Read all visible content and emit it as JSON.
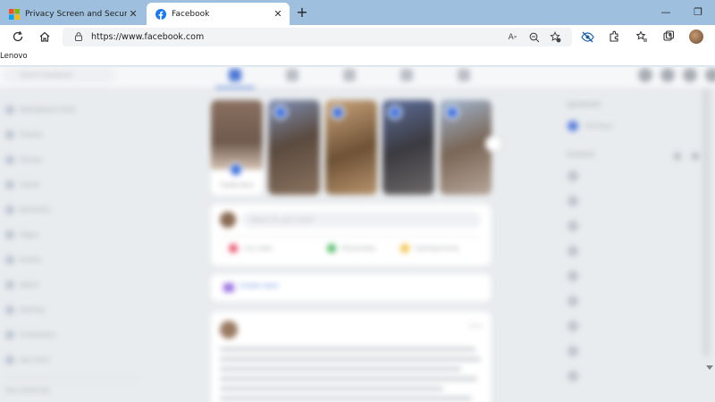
{
  "browser": {
    "tabs": [
      {
        "title": "Privacy Screen and Security Blur",
        "favicon": "microsoft-logo-icon",
        "active": false
      },
      {
        "title": "Facebook",
        "favicon": "facebook-logo-icon",
        "active": true
      }
    ],
    "url": "https://www.facebook.com",
    "favorites": [
      "Lenovo"
    ],
    "colors": {
      "tab_strip": "#9ec0de",
      "toolbar": "#ffffff",
      "omnibox": "#f1f3f4"
    },
    "icons": [
      "refresh-icon",
      "home-icon",
      "lock-icon",
      "read-aloud-icon",
      "zoom-out-icon",
      "add-favorite-icon",
      "eye-slash-icon",
      "extensions-icon",
      "favorites-icon",
      "collections-icon",
      "profile-avatar"
    ]
  },
  "page": {
    "state": "blurred",
    "colors": {
      "background": "#e9ecef",
      "card": "#ffffff",
      "accent": "#4b77d6"
    },
    "header": {
      "search_placeholder": "Search Facebook"
    },
    "left_menu": [
      "Marketplace Feed",
      "Friends",
      "Groups",
      "Saved",
      "Memories",
      "Pages",
      "Events",
      "Watch",
      "Gaming",
      "Fundraisers",
      "Ads Manager",
      "See more"
    ],
    "left_footer": "Your shortcuts",
    "stories": {
      "create_label": "Create story",
      "names": [
        "",
        "",
        "",
        ""
      ]
    },
    "composer": {
      "placeholder": "What's on your mind?",
      "actions": [
        "Live video",
        "Photo/video",
        "Feeling/activity"
      ]
    },
    "room": {
      "label": "Create room"
    },
    "post": {
      "author": "",
      "time": ""
    },
    "right_column": {
      "sponsored": "Sponsored",
      "birthdays": "Birthdays",
      "contacts_title": "Contacts",
      "contacts": [
        "",
        "",
        "",
        "",
        "",
        "",
        "",
        "",
        "",
        "",
        ""
      ]
    }
  }
}
